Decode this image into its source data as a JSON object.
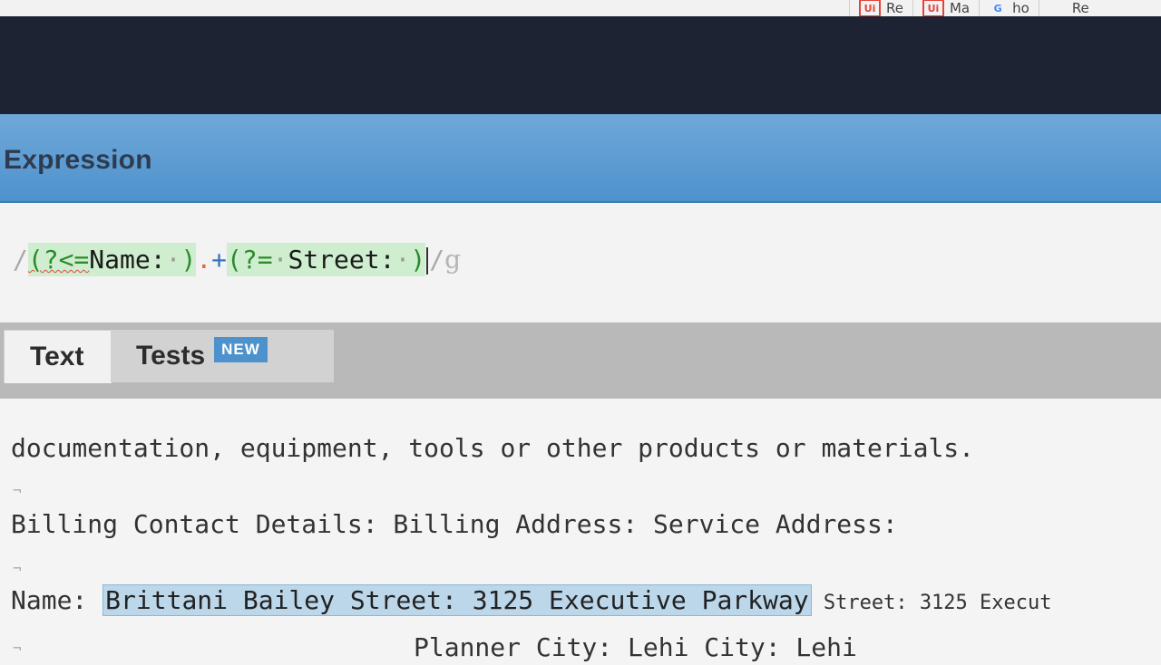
{
  "browser": {
    "bookmarks": [
      {
        "icon": "ui-icon",
        "label": "Re"
      },
      {
        "icon": "ui-icon",
        "label": "Ma"
      },
      {
        "icon": "google-icon",
        "label": "ho"
      },
      {
        "icon": "microsoft-icon",
        "label": "Re"
      }
    ]
  },
  "expression": {
    "title": "Expression",
    "delim_open": "/",
    "lookbehind_open": "(?<=",
    "lookbehind_text": "Name:",
    "lookbehind_close": ")",
    "dot": ".",
    "plus": "+",
    "lookahead_open": "(?=",
    "lookahead_text": "Street:",
    "lookahead_close": ")",
    "delim_close": "/",
    "flags": "g"
  },
  "tabs": {
    "text_label": "Text",
    "tests_label": "Tests",
    "new_badge": "NEW"
  },
  "editor": {
    "line1": "documentation, equipment, tools or other products or materials.",
    "line2": "Billing Contact Details: Billing Address: Service Address:",
    "line3_prefix": "Name: ",
    "line3_match": "Brittani Bailey Street: 3125 Executive Parkway",
    "line3_suffix": " Street: 3125 Execut",
    "line4": "Planner City: Lehi  City: Lehi",
    "eol_mark": "¬"
  },
  "colors": {
    "header_dark": "#1d2333",
    "expression_blue": "#4e92cd",
    "group_green": "#cfeecf",
    "match_blue": "#bcd6ea",
    "new_badge": "#4e92cd"
  }
}
